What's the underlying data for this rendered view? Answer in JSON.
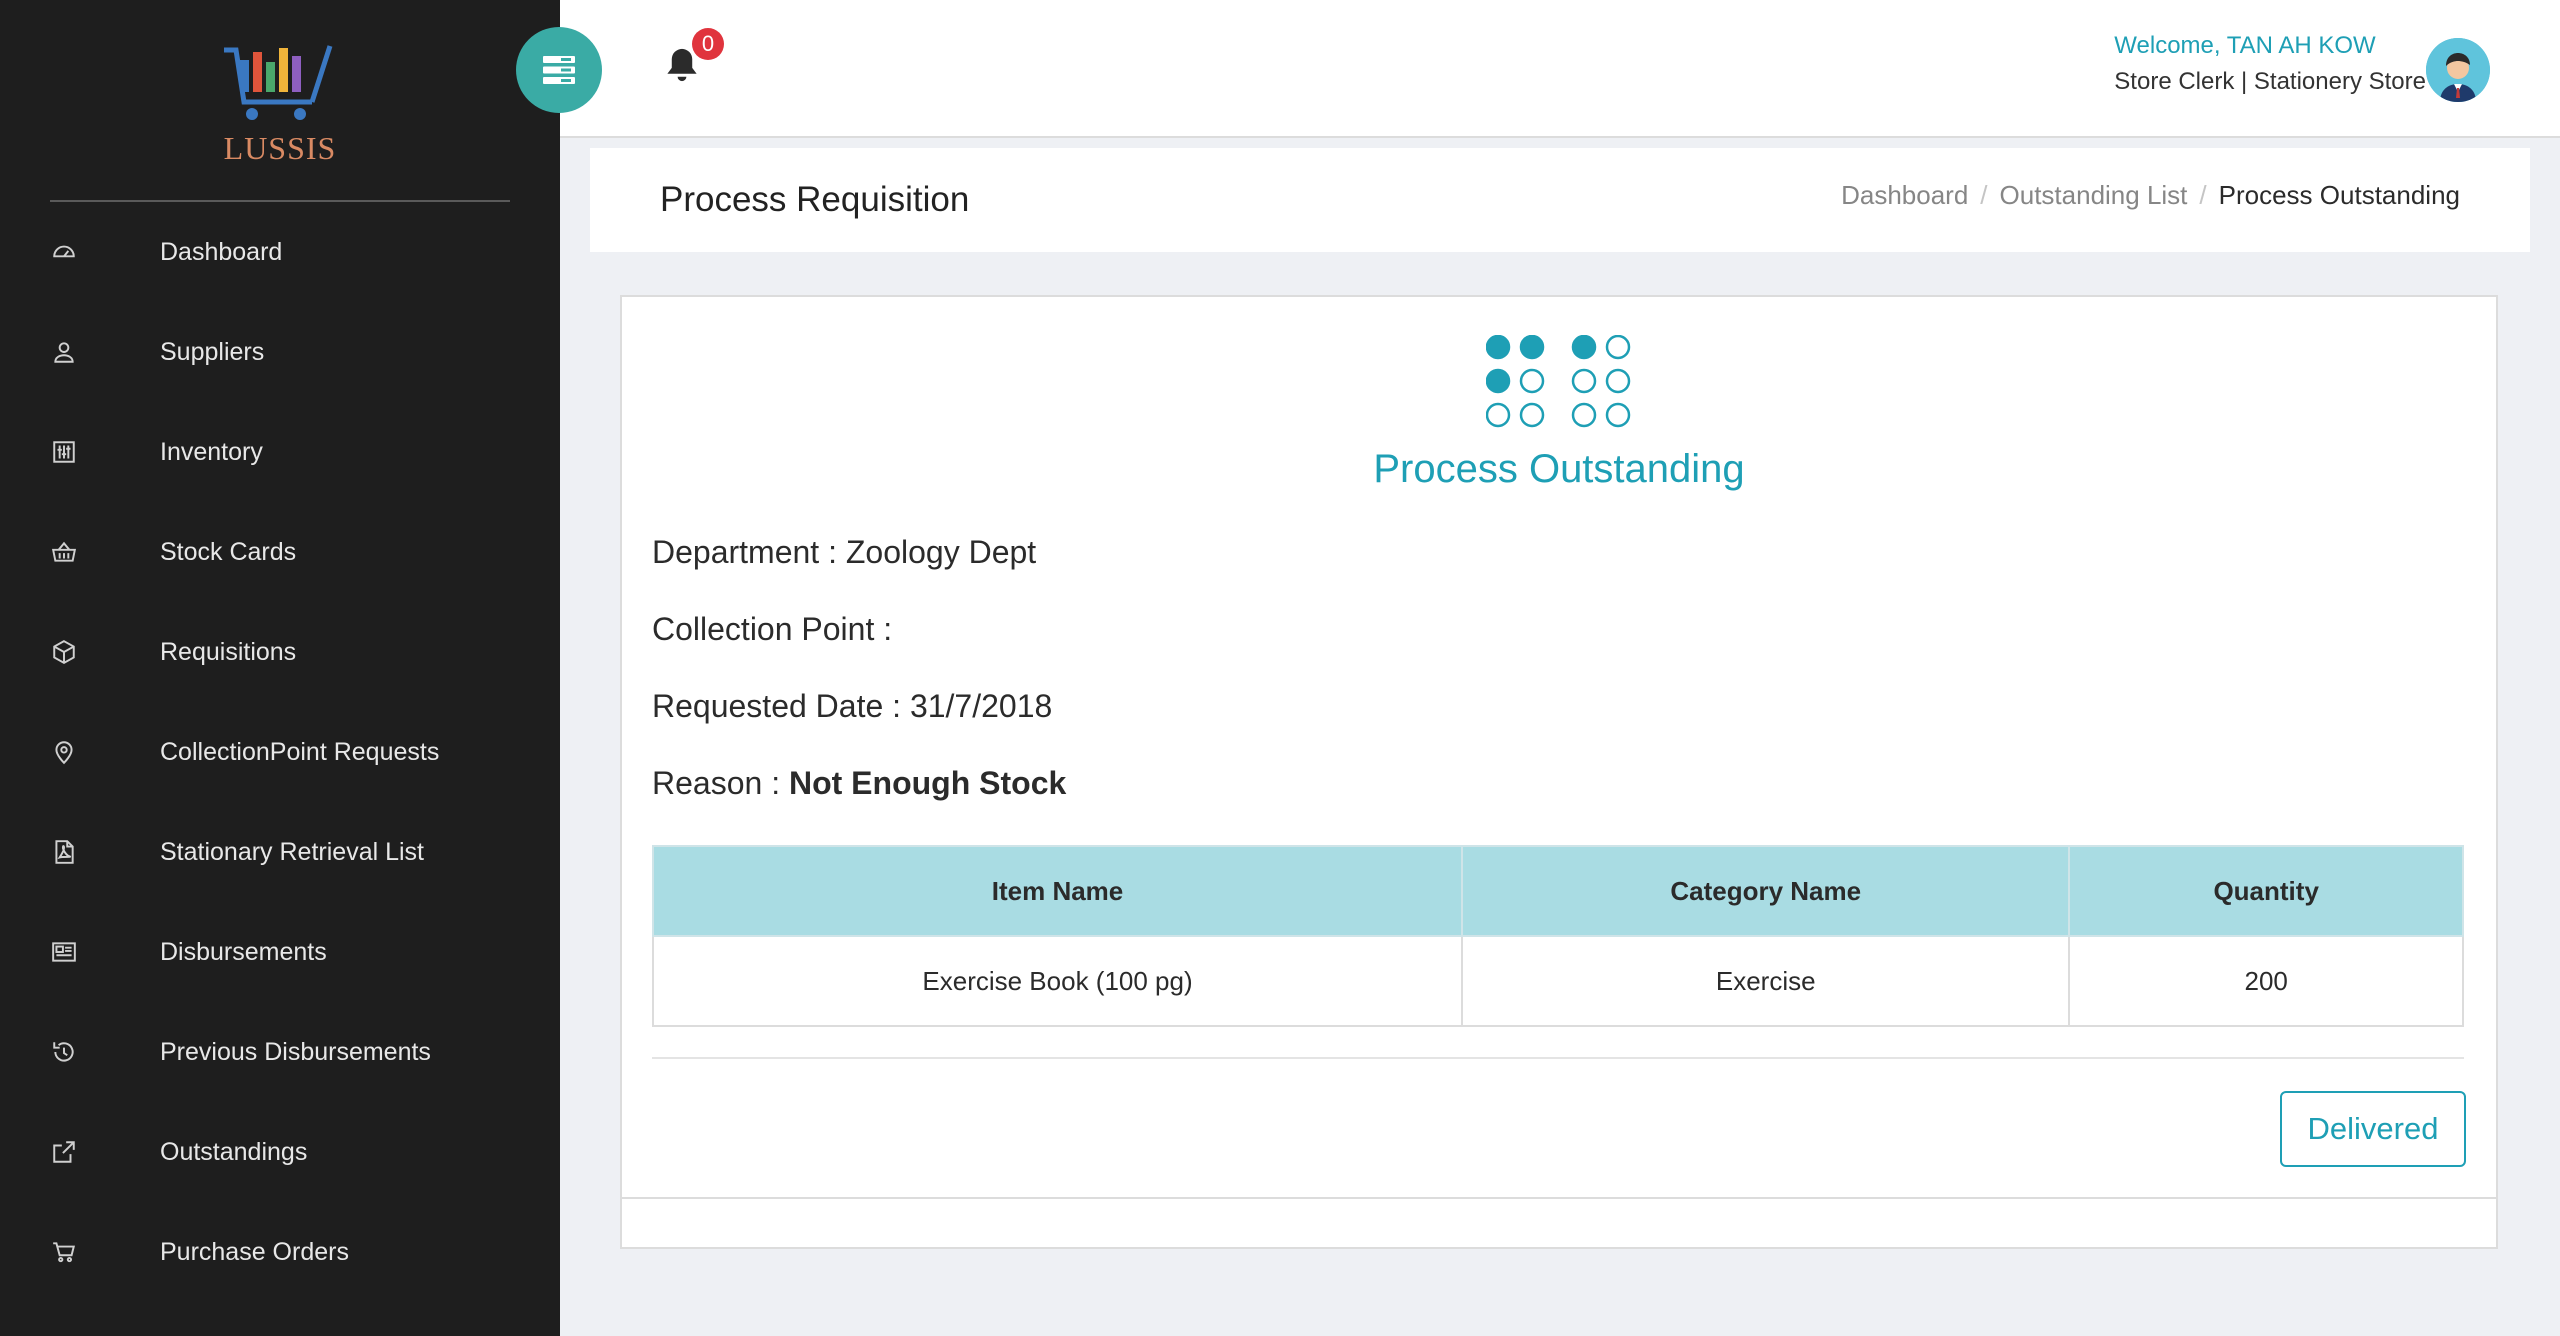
{
  "brand": {
    "name": "LUSSIS"
  },
  "sidebar": {
    "items": [
      {
        "label": "Dashboard",
        "icon": "dashboard-icon"
      },
      {
        "label": "Suppliers",
        "icon": "user-icon"
      },
      {
        "label": "Inventory",
        "icon": "sliders-icon"
      },
      {
        "label": "Stock Cards",
        "icon": "basket-icon"
      },
      {
        "label": "Requisitions",
        "icon": "box-icon"
      },
      {
        "label": "CollectionPoint Requests",
        "icon": "map-pin-icon"
      },
      {
        "label": "Stationary Retrieval List",
        "icon": "pdf-file-icon"
      },
      {
        "label": "Disbursements",
        "icon": "newspaper-icon"
      },
      {
        "label": "Previous Disbursements",
        "icon": "history-icon"
      },
      {
        "label": "Outstandings",
        "icon": "external-link-icon"
      },
      {
        "label": "Purchase Orders",
        "icon": "cart-icon"
      }
    ]
  },
  "topbar": {
    "notification_count": "0",
    "welcome": "Welcome, TAN AH KOW",
    "role": "Store Clerk | Stationery Store"
  },
  "page": {
    "title": "Process Requisition",
    "breadcrumb": {
      "items": [
        "Dashboard",
        "Outstanding List"
      ],
      "current": "Process Outstanding"
    }
  },
  "card": {
    "heading": "Process Outstanding",
    "department": "Department : Zoology Dept",
    "collection_point": "Collection Point :",
    "requested_date": "Requested Date : 31/7/2018",
    "reason_label": "Reason : ",
    "reason_value": "Not Enough Stock",
    "table": {
      "headers": [
        "Item Name",
        "Category Name",
        "Quantity"
      ],
      "rows": [
        [
          "Exercise Book (100 pg)",
          "Exercise",
          "200"
        ]
      ]
    },
    "delivered_button": "Delivered"
  },
  "colors": {
    "sidebar_bg": "#1e1e1e",
    "accent": "#1e9fb5",
    "toggle": "#3aaba5",
    "badge": "#e0343d",
    "table_header": "#a9dce3"
  }
}
